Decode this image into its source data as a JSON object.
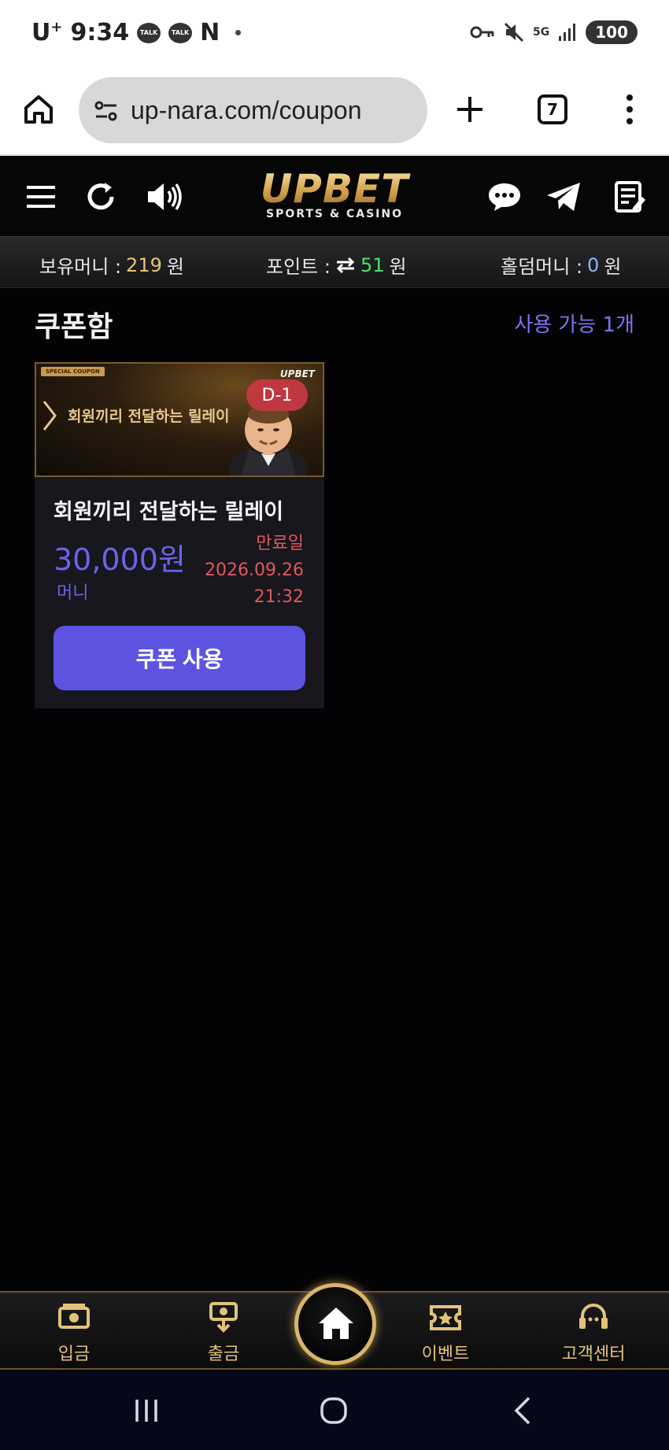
{
  "status_bar": {
    "carrier": "U",
    "carrier_sup": "+",
    "time": "9:34",
    "talk_label": "TALK",
    "netflix_letter": "N",
    "network": "5G",
    "battery": "100"
  },
  "browser": {
    "url": "up-nara.com/coupon",
    "tab_count": "7"
  },
  "site": {
    "logo_main": "UPBET",
    "logo_sub": "SPORTS & CASINO"
  },
  "balances": {
    "money_label": "보유머니 :",
    "money_value": "219",
    "money_unit": "원",
    "point_label": "포인트 :",
    "point_value": "51",
    "point_unit": "원",
    "holdem_label": "홀덤머니 :",
    "holdem_value": "0",
    "holdem_unit": "원"
  },
  "coupon_box": {
    "title": "쿠폰함",
    "available": "사용 가능 1개"
  },
  "coupon": {
    "banner_tag": "SPECIAL COUPON",
    "banner_text": "회원끼리 전달하는 릴레이",
    "banner_brand": "UPBET",
    "dday": "D-1",
    "title": "회원끼리 전달하는 릴레이",
    "amount": "30,000원",
    "unit": "머니",
    "expiry_label": "만료일",
    "expiry_date": "2026.09.26",
    "expiry_time": "21:32",
    "use_button": "쿠폰 사용"
  },
  "bottom_nav": {
    "deposit": "입금",
    "withdraw": "출금",
    "event": "이벤트",
    "support": "고객센터"
  },
  "colors": {
    "accent": "#5c54e0",
    "gold": "#e3c27a",
    "expiry": "#e0585c",
    "dday": "#c0383f"
  }
}
